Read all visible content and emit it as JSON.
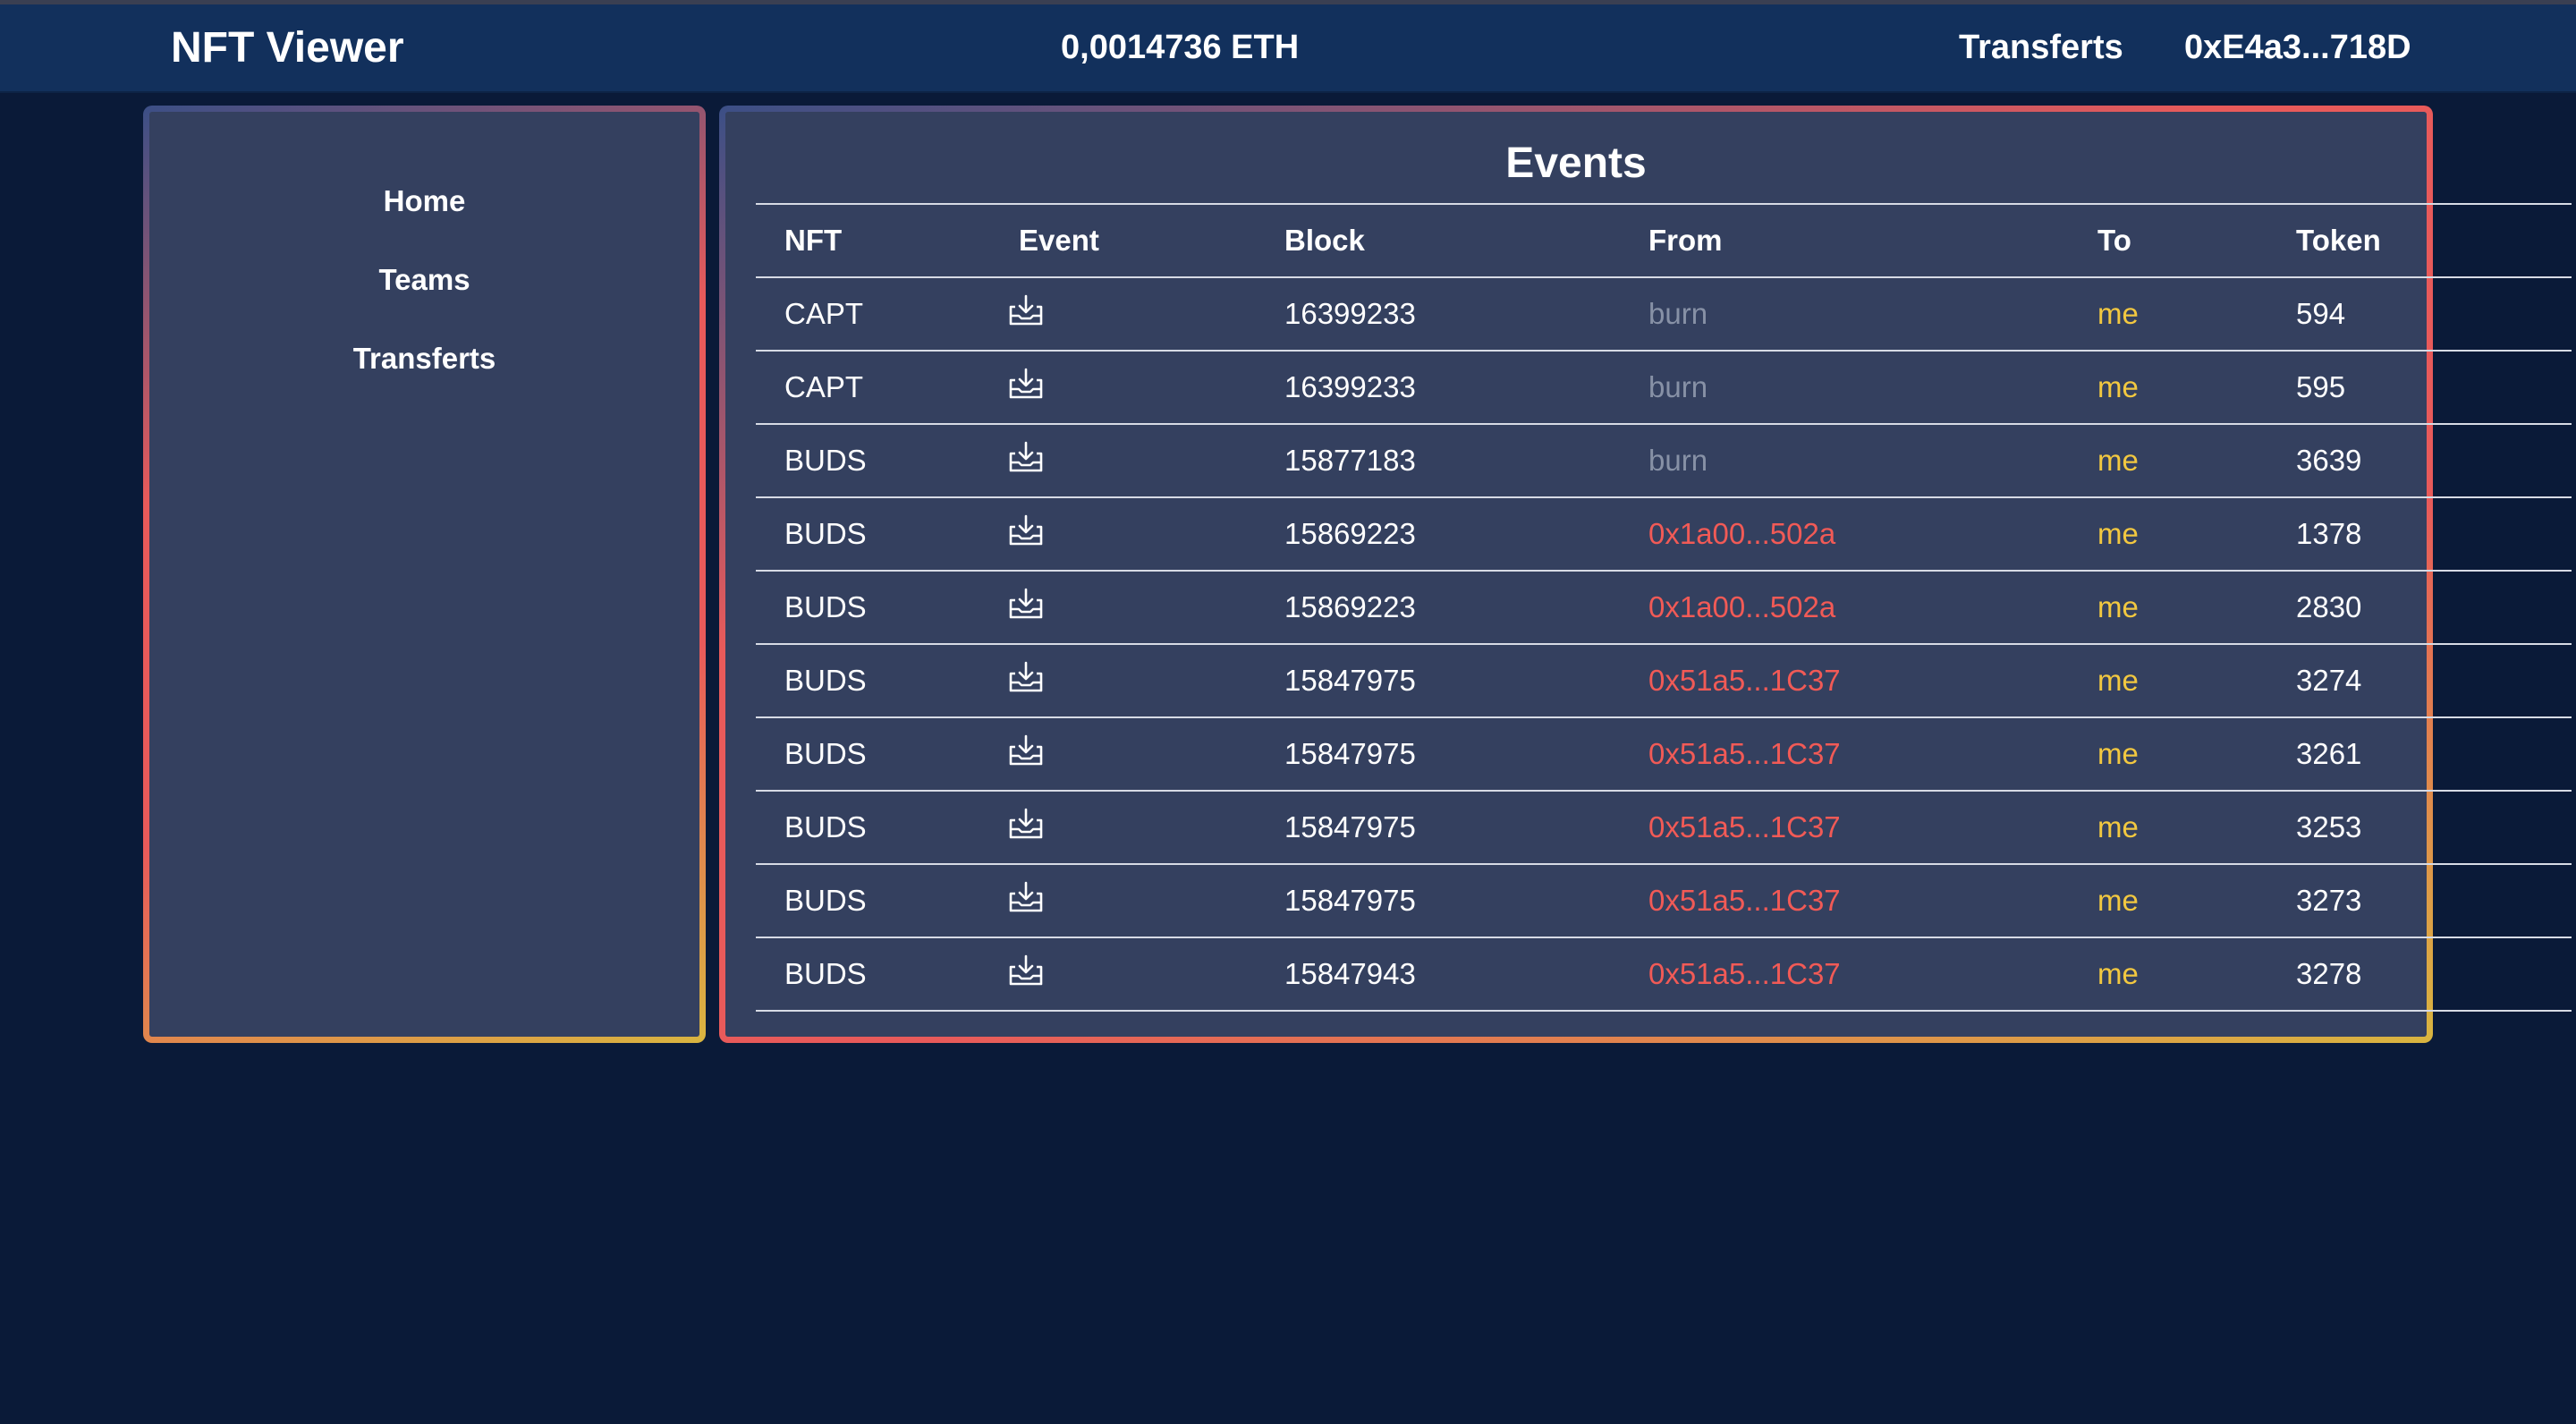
{
  "header": {
    "brand": "NFT Viewer",
    "balance": "0,0014736 ETH",
    "nav_transfers": "Transferts",
    "wallet": "0xE4a3...718D"
  },
  "sidebar": {
    "items": [
      {
        "label": "Home"
      },
      {
        "label": "Teams"
      },
      {
        "label": "Transferts"
      }
    ]
  },
  "events": {
    "title": "Events",
    "columns": [
      "NFT",
      "Event",
      "Block",
      "From",
      "To",
      "Token"
    ],
    "event_icon": "download-tray-icon",
    "rows": [
      {
        "nft": "CAPT",
        "block": "16399233",
        "from": "burn",
        "to": "me",
        "token": "594"
      },
      {
        "nft": "CAPT",
        "block": "16399233",
        "from": "burn",
        "to": "me",
        "token": "595"
      },
      {
        "nft": "BUDS",
        "block": "15877183",
        "from": "burn",
        "to": "me",
        "token": "3639"
      },
      {
        "nft": "BUDS",
        "block": "15869223",
        "from": "0x1a00...502a",
        "to": "me",
        "token": "1378"
      },
      {
        "nft": "BUDS",
        "block": "15869223",
        "from": "0x1a00...502a",
        "to": "me",
        "token": "2830"
      },
      {
        "nft": "BUDS",
        "block": "15847975",
        "from": "0x51a5...1C37",
        "to": "me",
        "token": "3274"
      },
      {
        "nft": "BUDS",
        "block": "15847975",
        "from": "0x51a5...1C37",
        "to": "me",
        "token": "3261"
      },
      {
        "nft": "BUDS",
        "block": "15847975",
        "from": "0x51a5...1C37",
        "to": "me",
        "token": "3253"
      },
      {
        "nft": "BUDS",
        "block": "15847975",
        "from": "0x51a5...1C37",
        "to": "me",
        "token": "3273"
      },
      {
        "nft": "BUDS",
        "block": "15847943",
        "from": "0x51a5...1C37",
        "to": "me",
        "token": "3278"
      }
    ]
  },
  "colors": {
    "page_bg": "#0a1a38",
    "navbar_bg": "#12305c",
    "panel_bg": "#34405f",
    "burn": "#8791a6",
    "address": "#f15a56",
    "me": "#f2c840",
    "border_gradient": [
      "#3b4f86",
      "#e85a5a",
      "#d9b540"
    ]
  }
}
